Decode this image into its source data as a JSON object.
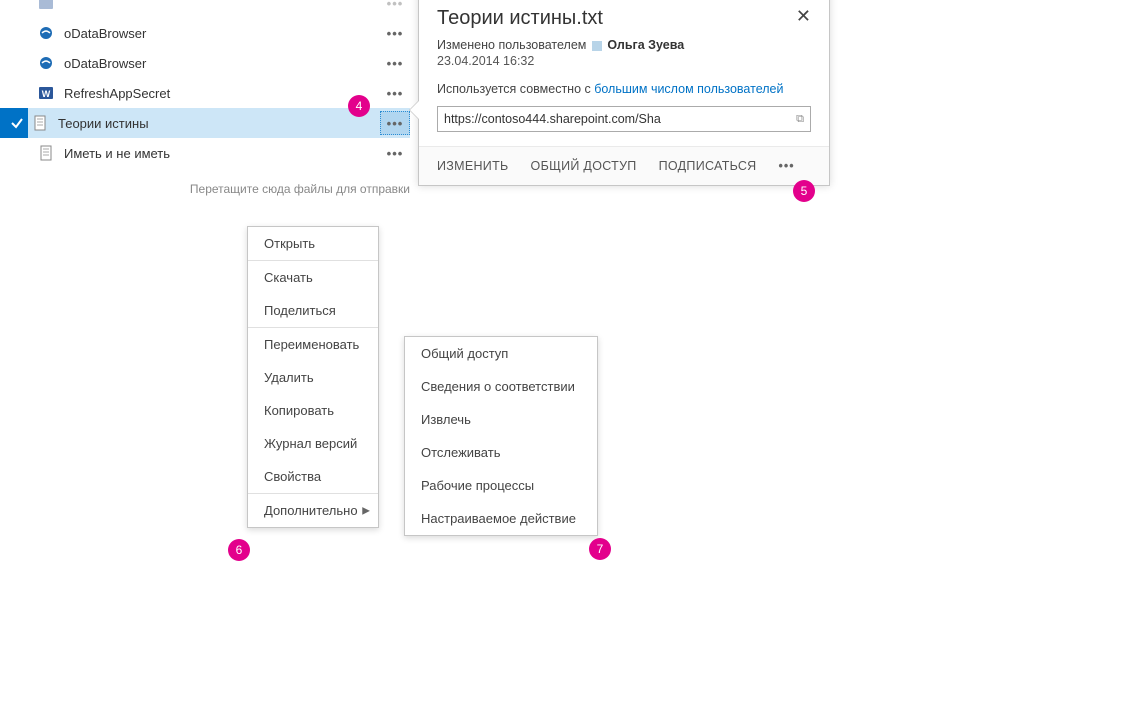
{
  "files": [
    {
      "name": "oDataBrowser",
      "icon": "ie",
      "selected": false
    },
    {
      "name": "oDataBrowser",
      "icon": "ie",
      "selected": false
    },
    {
      "name": "RefreshAppSecret",
      "icon": "word",
      "selected": false
    },
    {
      "name": "Теории истины",
      "icon": "text",
      "selected": true
    },
    {
      "name": "Иметь и не иметь",
      "icon": "text",
      "selected": false
    }
  ],
  "drop_hint": "Перетащите сюда файлы для отправки",
  "callout": {
    "title": "Теории истины.txt",
    "modified_prefix": "Изменено пользователем",
    "user": "Ольга Зуева",
    "timestamp": "23.04.2014 16:32",
    "share_prefix": "Используется совместно с ",
    "share_link": "большим числом пользователей",
    "url": "https://contoso444.sharepoint.com/Sha",
    "footer": {
      "edit": "ИЗМЕНИТЬ",
      "share": "ОБЩИЙ ДОСТУП",
      "follow": "ПОДПИСАТЬСЯ"
    }
  },
  "menu1": {
    "open": "Открыть",
    "download": "Скачать",
    "share": "Поделиться",
    "rename": "Переименовать",
    "delete": "Удалить",
    "copy": "Копировать",
    "versions": "Журнал версий",
    "properties": "Свойства",
    "advanced": "Дополнительно"
  },
  "menu2": {
    "share": "Общий доступ",
    "compliance": "Сведения о соответствии",
    "checkout": "Извлечь",
    "follow": "Отслеживать",
    "workflows": "Рабочие процессы",
    "custom": "Настраиваемое действие"
  },
  "badges": {
    "b4": "4",
    "b5": "5",
    "b6": "6",
    "b7": "7"
  },
  "ellipsis": "•••"
}
